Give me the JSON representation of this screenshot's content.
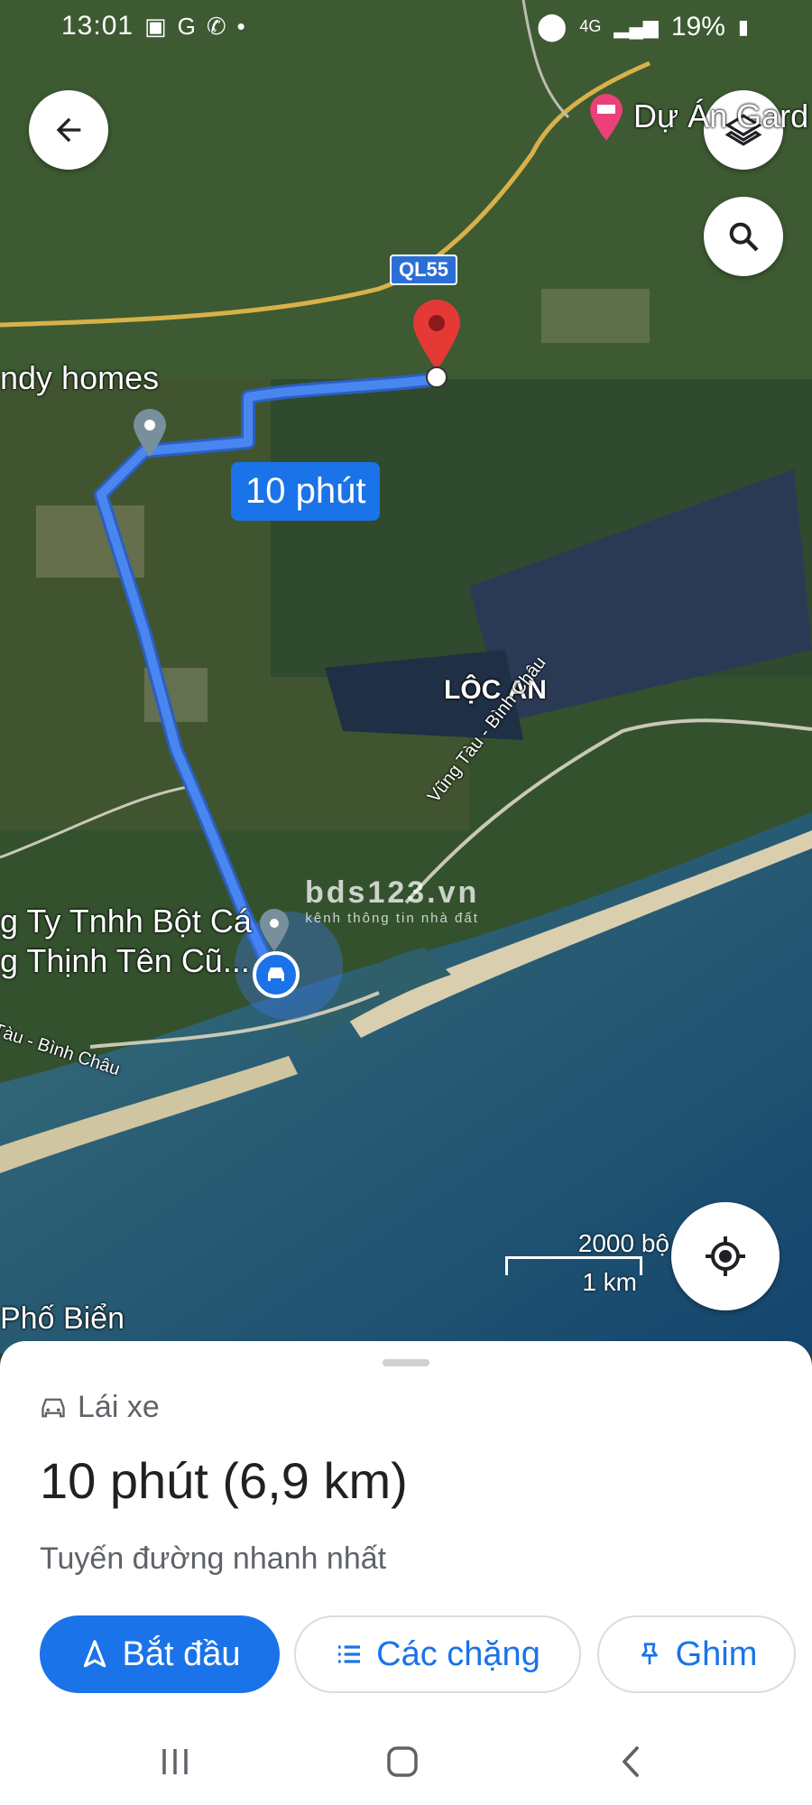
{
  "status_bar": {
    "time": "13:01",
    "network": "4G",
    "battery": "19%"
  },
  "map": {
    "poi_top_label": "Dự Án Gard",
    "road_shield": "QL55",
    "route_badge": "10 phút",
    "place_left_top": "ndy homes",
    "area_label": "LỘC AN",
    "road_label_east": "Vũng Tàu - Bình Châu",
    "road_label_west": "Tàu - Bình Châu",
    "origin_label_line1": "g Ty Tnhh Bột Cá",
    "origin_label_line2": "g Thịnh Tên Cũ...",
    "bottom_left_label": "Phố Biển",
    "scale_imperial": "2000 bộ",
    "scale_metric": "1 km",
    "watermark_main": "bds123.vn",
    "watermark_sub": "kênh thông tin nhà đất"
  },
  "sheet": {
    "mode_label": "Lái xe",
    "eta": "10 phút",
    "distance": "(6,9 km)",
    "subtitle": "Tuyến đường nhanh nhất",
    "start_label": "Bắt đầu",
    "steps_label": "Các chặng",
    "pin_label": "Ghim"
  },
  "colors": {
    "accent": "#1a73e8",
    "route": "#4a86f0",
    "destination_pin": "#e53935"
  }
}
